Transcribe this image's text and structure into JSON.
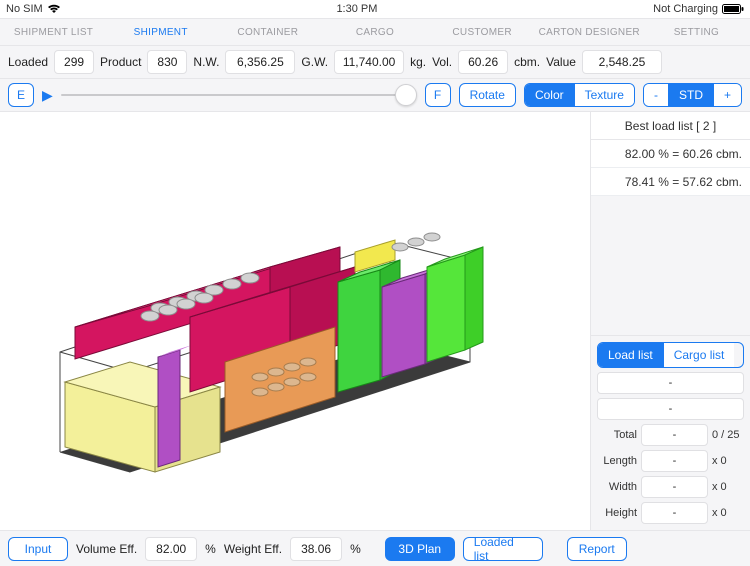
{
  "status": {
    "sim": "No SIM",
    "time": "1:30 PM",
    "charging": "Not Charging"
  },
  "tabs": [
    "SHIPMENT LIST",
    "SHIPMENT",
    "CONTAINER",
    "CARGO",
    "CUSTOMER",
    "CARTON DESIGNER",
    "SETTING"
  ],
  "active_tab_index": 1,
  "stats": {
    "loaded_label": "Loaded",
    "loaded": "299",
    "product_label": "Product",
    "product": "830",
    "nw_label": "N.W.",
    "nw": "6,356.25",
    "gw_label": "G.W.",
    "gw": "11,740.00",
    "kg": "kg.",
    "vol_label": "Vol.",
    "vol": "60.26",
    "cbm": "cbm.",
    "value_label": "Value",
    "value": "2,548.25"
  },
  "tools": {
    "e": "E",
    "f": "F",
    "rotate": "Rotate",
    "color": "Color",
    "texture": "Texture",
    "minus": "-",
    "std": "STD",
    "plus": "+"
  },
  "best": {
    "header": "Best load list [ 2 ]",
    "items": [
      "82.00 % = 60.26 cbm.",
      "78.41 % = 57.62 cbm."
    ]
  },
  "lists": {
    "load_list": "Load list",
    "cargo_list": "Cargo list",
    "dash": "-",
    "total_lbl": "Total",
    "total_unit": "0 / 25",
    "length_lbl": "Length",
    "length_unit": "x 0",
    "width_lbl": "Width",
    "width_unit": "x 0",
    "height_lbl": "Height",
    "height_unit": "x 0"
  },
  "bottom": {
    "input": "Input",
    "vol_eff_lbl": "Volume Eff.",
    "vol_eff": "82.00",
    "pct": "%",
    "wt_eff_lbl": "Weight Eff.",
    "wt_eff": "38.06",
    "plan3d": "3D Plan",
    "loaded_list": "Loaded list",
    "report": "Report"
  }
}
